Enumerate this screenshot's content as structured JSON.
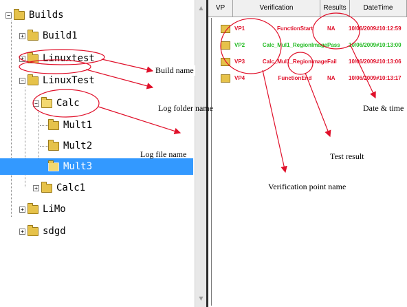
{
  "tree": {
    "nodes": [
      {
        "label": "Builds",
        "expander": "−"
      },
      {
        "label": "Build1",
        "expander": "+"
      },
      {
        "label": "Linuxtest",
        "expander": "+"
      },
      {
        "label": "LinuxTest",
        "expander": "−"
      },
      {
        "label": "Calc",
        "expander": "−"
      },
      {
        "label": "Mult1"
      },
      {
        "label": "Mult2"
      },
      {
        "label": "Mult3",
        "selected": true
      },
      {
        "label": "Calc1",
        "expander": "+"
      },
      {
        "label": "LiMo",
        "expander": "+"
      },
      {
        "label": "sdgd",
        "expander": "+"
      }
    ]
  },
  "grid": {
    "headers": [
      "VP",
      "Verification",
      "Results",
      "DateTime"
    ],
    "rows": [
      {
        "vp": "VP1",
        "verification": "FunctionStart",
        "result": "NA",
        "datetime": "10/06/2009#10:12:59",
        "color": "#e0102a"
      },
      {
        "vp": "VP2",
        "verification": "Calc_Mul1_RegionImage",
        "result": "Pass",
        "datetime": "10/06/2009#10:13:00",
        "color": "#22bb22"
      },
      {
        "vp": "VP3",
        "verification": "Calc_Mul1_RegionImage",
        "result": "Fail",
        "datetime": "10/06/2009#10:13:06",
        "color": "#e0102a"
      },
      {
        "vp": "VP4",
        "verification": "FunctionEnd",
        "result": "NA",
        "datetime": "10/06/2009#10:13:17",
        "color": "#e0102a"
      }
    ]
  },
  "annotations": {
    "build_name": "Build name",
    "log_folder_name": "Log folder name",
    "log_file_name": "Log file name",
    "date_time": "Date & time",
    "test_result": "Test result",
    "verification_point_name": "Verification point name"
  },
  "colors": {
    "selection": "#3399ff",
    "annotation_red": "#e0102a",
    "pass_green": "#22bb22"
  }
}
